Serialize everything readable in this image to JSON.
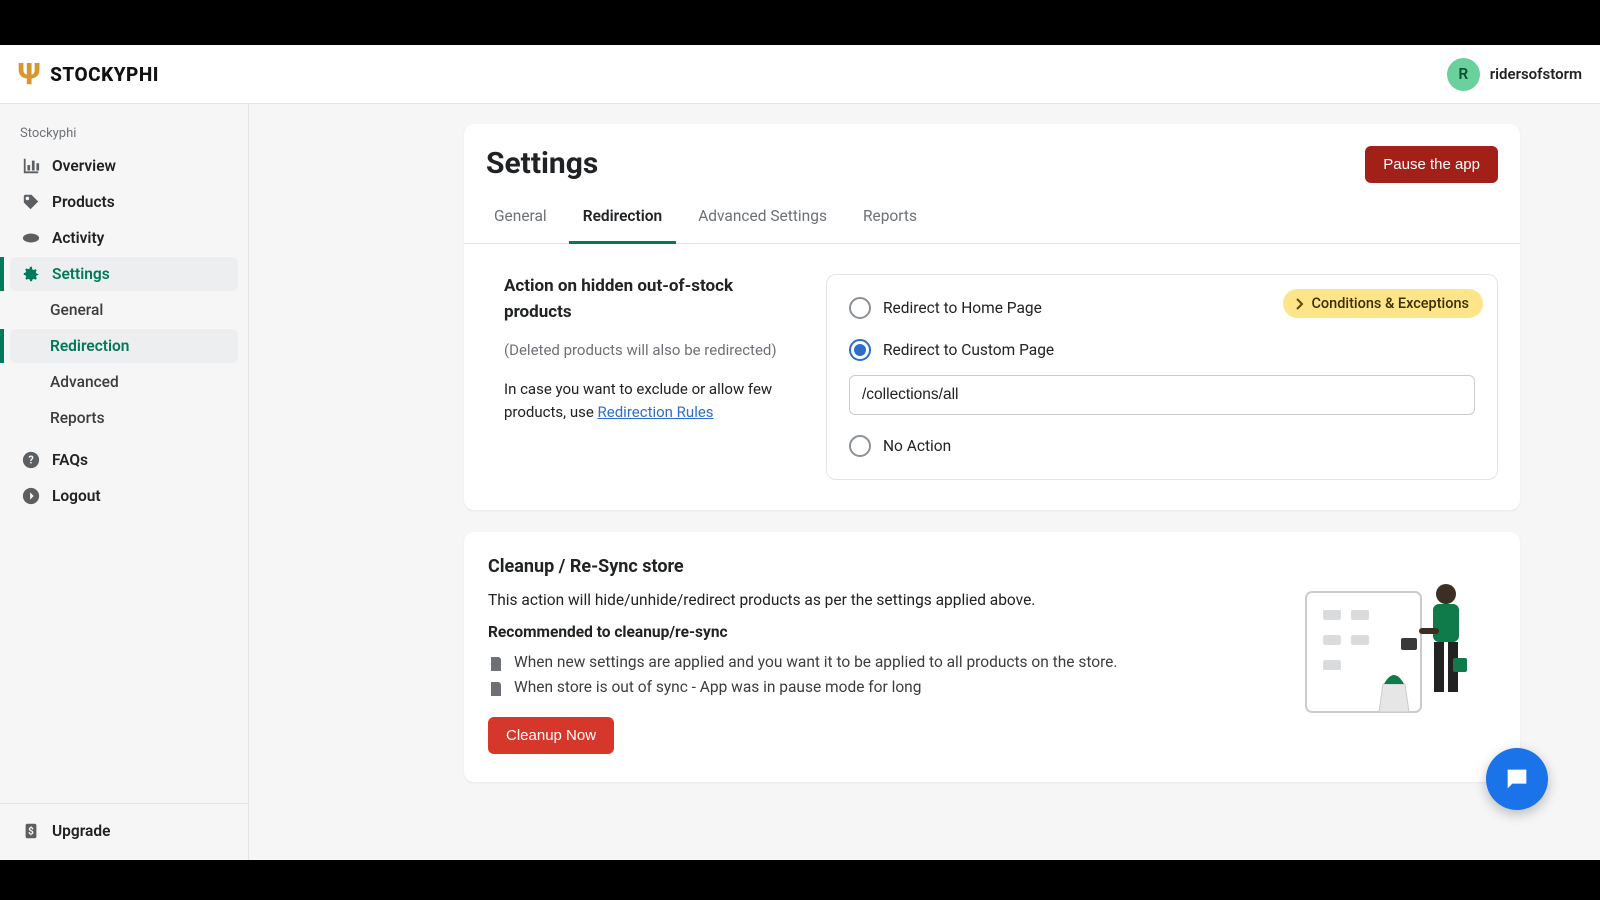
{
  "brand": {
    "name": "STOCKYPHI",
    "sidebar_heading": "Stockyphi"
  },
  "user": {
    "initial": "R",
    "name": "ridersofstorm"
  },
  "sidebar": {
    "items": [
      {
        "label": "Overview"
      },
      {
        "label": "Products"
      },
      {
        "label": "Activity"
      },
      {
        "label": "Settings"
      },
      {
        "label": "General"
      },
      {
        "label": "Redirection"
      },
      {
        "label": "Advanced"
      },
      {
        "label": "Reports"
      },
      {
        "label": "FAQs"
      },
      {
        "label": "Logout"
      }
    ],
    "upgrade": "Upgrade"
  },
  "page": {
    "title": "Settings",
    "pause_button": "Pause the app"
  },
  "tabs": [
    {
      "label": "General"
    },
    {
      "label": "Redirection"
    },
    {
      "label": "Advanced Settings"
    },
    {
      "label": "Reports"
    }
  ],
  "redirect": {
    "heading": "Action on hidden out-of-stock products",
    "subnote": "(Deleted products will also be redirected)",
    "exclude_prefix": "In case you want to exclude or allow few products, use ",
    "exclude_link": "Redirection Rules",
    "chip": "Conditions & Exceptions",
    "options": {
      "home": "Redirect to Home Page",
      "custom": "Redirect to Custom Page",
      "none": "No Action"
    },
    "custom_url": "/collections/all"
  },
  "cleanup": {
    "heading": "Cleanup / Re-Sync store",
    "desc": "This action will hide/unhide/redirect products as per the settings applied above.",
    "recommend": "Recommended to cleanup/re-sync",
    "bullets": [
      "When new settings are applied and you want it to be applied to all products on the store.",
      "When store is out of sync - App was in pause mode for long"
    ],
    "button": "Cleanup Now"
  }
}
